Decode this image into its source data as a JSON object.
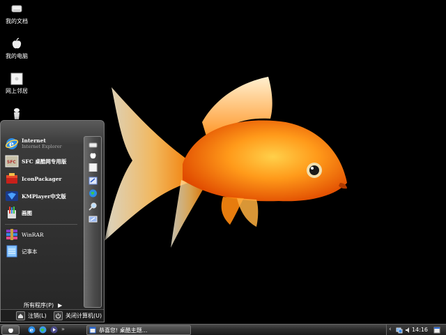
{
  "desktop": {
    "icons": [
      {
        "label": "我的文档",
        "icon": "drive-icon"
      },
      {
        "label": "我的电脑",
        "icon": "apple-icon"
      },
      {
        "label": "网上邻居",
        "icon": "network-icon"
      },
      {
        "label": "",
        "icon": "recycle-bin-icon"
      }
    ]
  },
  "start_menu": {
    "pinned": [
      {
        "title": "Internet",
        "subtitle": "Internet Explorer",
        "icon": "internet-explorer-icon"
      },
      {
        "title": "SFC 桌酷网专用版",
        "icon": "sfc-icon"
      },
      {
        "title": "IconPackager",
        "icon": "iconpackager-icon"
      },
      {
        "title": "KMPlayer中文版",
        "icon": "kmplayer-icon"
      },
      {
        "title": "画图",
        "icon": "paint-icon"
      }
    ],
    "recent": [
      {
        "title": "WinRAR",
        "icon": "winrar-icon"
      },
      {
        "title": "记事本",
        "icon": "notepad-icon"
      }
    ],
    "right_column_icons": [
      "drive-icon",
      "apple-icon",
      "network-icon",
      "control-panel-icon",
      "globe-icon",
      "search-icon",
      "run-icon"
    ],
    "all_programs": "所有程序(P)",
    "logoff": "注销(L)",
    "shutdown": "关闭计算机(U)"
  },
  "taskbar": {
    "task_label": "恭喜您! 桌酷主题...",
    "clock": "14:16",
    "colors": {
      "accent": "#ff8a00",
      "taskbar": "#2a2a2a"
    }
  }
}
